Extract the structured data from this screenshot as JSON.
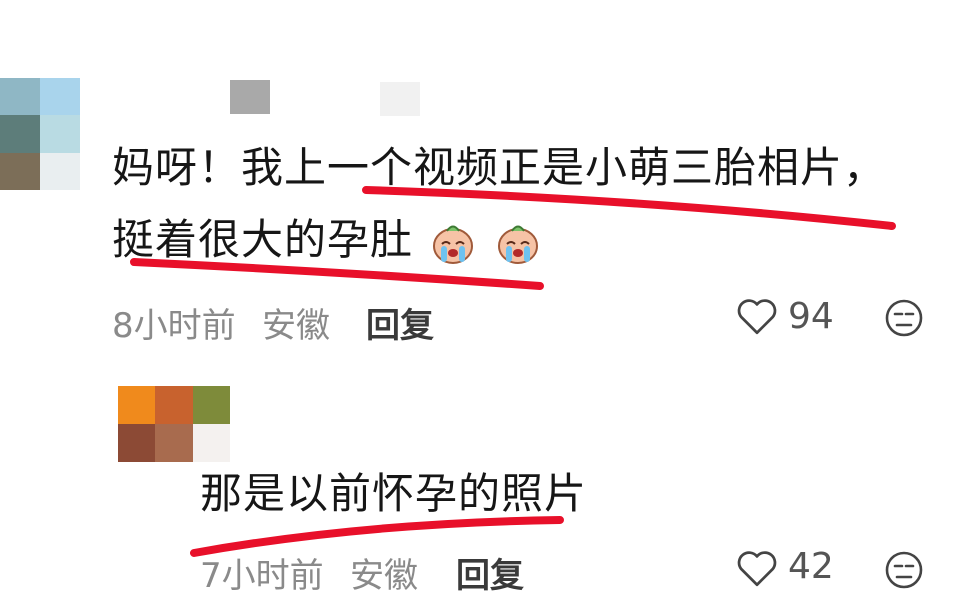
{
  "comments": [
    {
      "text_line1": "妈呀！我上一个视频正是小萌三胎相片，",
      "text_line2": "挺着很大的孕肚",
      "emoji": [
        "crying-face-emoji",
        "crying-face-emoji"
      ],
      "time": "8小时前",
      "location": "安徽",
      "reply_label": "回复",
      "likes": "94"
    },
    {
      "text_line1": "那是以前怀孕的照片",
      "time": "7小时前",
      "location": "安徽",
      "reply_label": "回复",
      "likes": "42"
    }
  ],
  "colors": {
    "underline": "#e8102a",
    "meta_text": "#8a8a8a"
  }
}
